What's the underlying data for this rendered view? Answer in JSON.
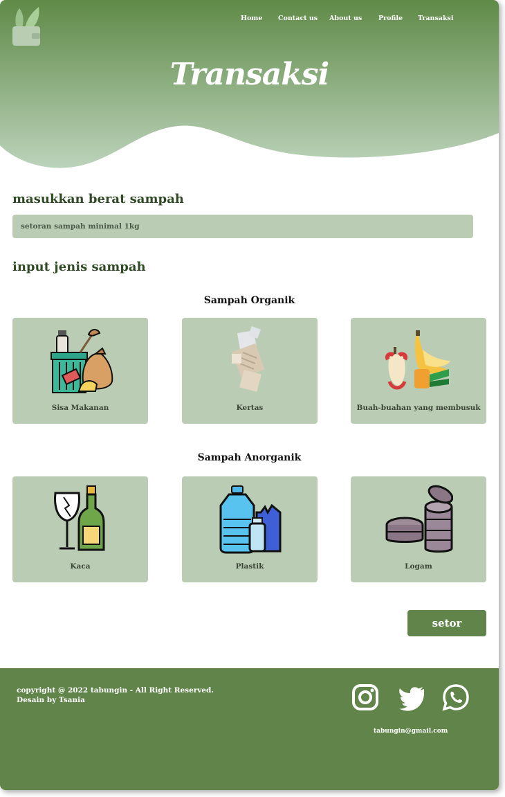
{
  "nav": {
    "items": [
      {
        "label": "Home"
      },
      {
        "label": "Contact us"
      },
      {
        "label": "About us"
      },
      {
        "label": "Profile"
      },
      {
        "label": "Transaksi"
      }
    ]
  },
  "hero": {
    "title": "Transaksi"
  },
  "weight": {
    "heading": "masukkan berat sampah",
    "placeholder": "setoran sampah minimal 1kg"
  },
  "type": {
    "heading": "input jenis sampah"
  },
  "organic": {
    "title": "Sampah Organik",
    "items": [
      {
        "label": "Sisa Makanan",
        "icon": "food-waste-icon"
      },
      {
        "label": "Kertas",
        "icon": "paper-icon"
      },
      {
        "label": "Buah-buahan yang membusuk",
        "icon": "rotten-fruit-icon"
      }
    ]
  },
  "inorganic": {
    "title": "Sampah Anorganik",
    "items": [
      {
        "label": "Kaca",
        "icon": "glass-icon"
      },
      {
        "label": "Plastik",
        "icon": "plastic-icon"
      },
      {
        "label": "Logam",
        "icon": "metal-can-icon"
      }
    ]
  },
  "actions": {
    "submit_label": "setor"
  },
  "footer": {
    "copyright": "copyright @ 2022 tabungin - All Right Reserved.",
    "credit": "Desain by Tsania",
    "email": "tabungin@gmail.com",
    "social": [
      "instagram-icon",
      "twitter-icon",
      "whatsapp-icon"
    ]
  },
  "colors": {
    "primary": "#608449",
    "card": "#bacdb4",
    "heading": "#2f4a25"
  }
}
